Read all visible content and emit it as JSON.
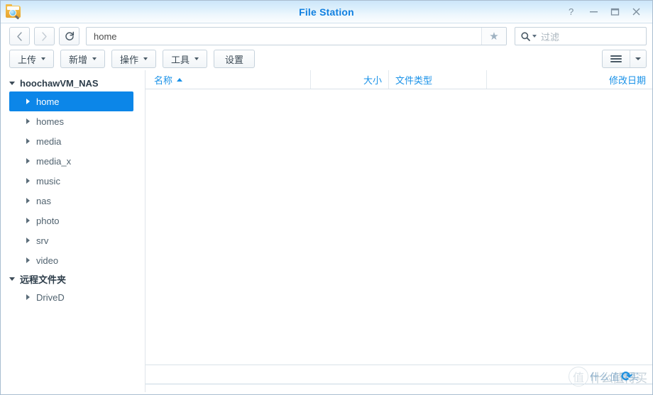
{
  "window": {
    "title": "File Station",
    "app_icon": "folder-search-icon",
    "controls": {
      "help": "?",
      "minimize": "minimize-icon",
      "maximize": "maximize-icon",
      "close": "close-icon"
    }
  },
  "navigation": {
    "back": "back-icon",
    "forward": "forward-icon",
    "refresh": "refresh-icon",
    "address_value": "home",
    "address_placeholder": "",
    "bookmark": "star-icon"
  },
  "search": {
    "icon": "search-icon",
    "placeholder": "过滤",
    "value": ""
  },
  "toolbar": {
    "buttons": [
      {
        "label": "上传",
        "has_caret": true
      },
      {
        "label": "新增",
        "has_caret": true
      },
      {
        "label": "操作",
        "has_caret": true
      },
      {
        "label": "工具",
        "has_caret": true
      },
      {
        "label": "设置",
        "has_caret": false
      }
    ],
    "view_mode": "list-view-icon",
    "view_caret": "chevron-down-icon"
  },
  "sidebar": {
    "root": {
      "label": "hoochawVM_NAS",
      "expanded": true
    },
    "items": [
      {
        "label": "home",
        "selected": true
      },
      {
        "label": "homes",
        "selected": false
      },
      {
        "label": "media",
        "selected": false
      },
      {
        "label": "media_x",
        "selected": false
      },
      {
        "label": "music",
        "selected": false
      },
      {
        "label": "nas",
        "selected": false
      },
      {
        "label": "photo",
        "selected": false
      },
      {
        "label": "srv",
        "selected": false
      },
      {
        "label": "video",
        "selected": false
      }
    ],
    "remote": {
      "label": "远程文件夹",
      "expanded": true
    },
    "remote_items": [
      {
        "label": "DriveD",
        "selected": false
      }
    ]
  },
  "file_list": {
    "columns": [
      {
        "label": "名称",
        "sorted": "asc"
      },
      {
        "label": "大小",
        "sorted": ""
      },
      {
        "label": "文件类型",
        "sorted": ""
      },
      {
        "label": "修改日期",
        "sorted": ""
      }
    ],
    "rows": [],
    "status_text": ""
  },
  "watermark": {
    "badge": "值",
    "text": "什么值得买",
    "overlay_text": "什么值得买",
    "refresh_glyph": "⟳"
  },
  "colors": {
    "accent": "#1180e0",
    "selection": "#0c86e8",
    "header_link": "#1a92e8",
    "titlebar_top": "#cce6fa",
    "border": "#c6d2dc"
  }
}
